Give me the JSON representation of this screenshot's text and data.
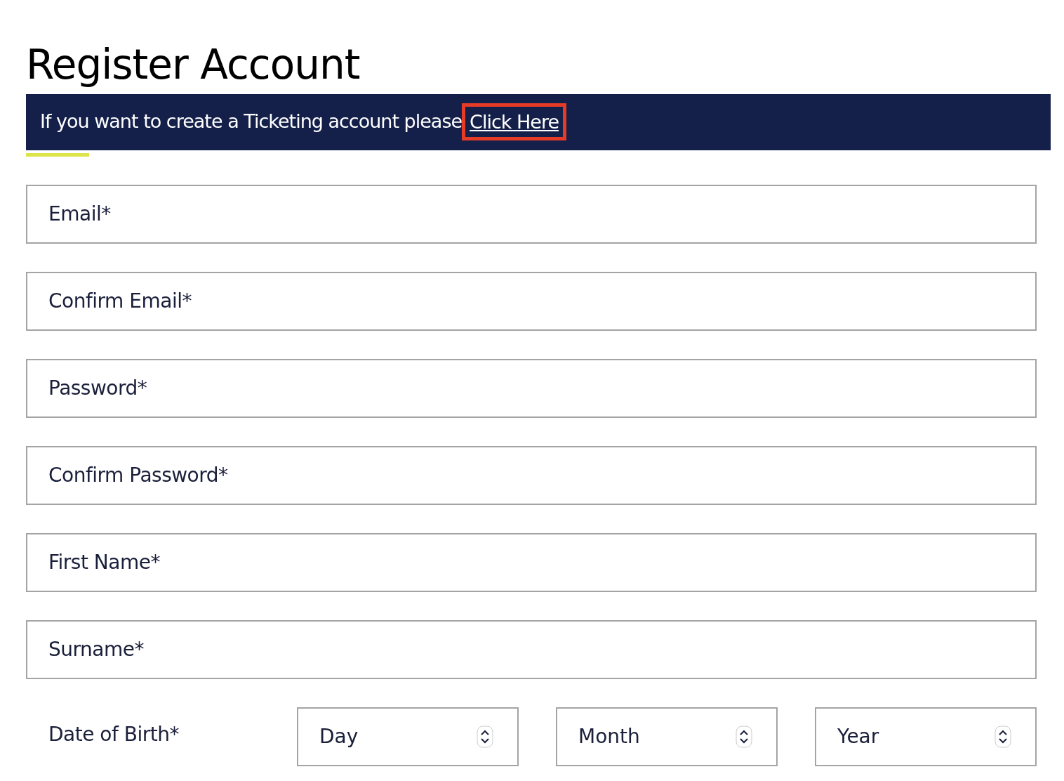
{
  "title": "Register Account",
  "banner": {
    "text": "If you want to create a Ticketing account please",
    "link": {
      "label": "Click Here",
      "highlighted": true
    }
  },
  "fields": [
    {
      "placeholder": "Email*"
    },
    {
      "placeholder": "Confirm Email*"
    },
    {
      "placeholder": "Password*"
    },
    {
      "placeholder": "Confirm Password*"
    },
    {
      "placeholder": "First Name*"
    },
    {
      "placeholder": "Surname*"
    }
  ],
  "date_of_birth": {
    "label": "Date of Birth*",
    "selects": [
      {
        "placeholder": "Day"
      },
      {
        "placeholder": "Month"
      },
      {
        "placeholder": "Year"
      }
    ]
  }
}
